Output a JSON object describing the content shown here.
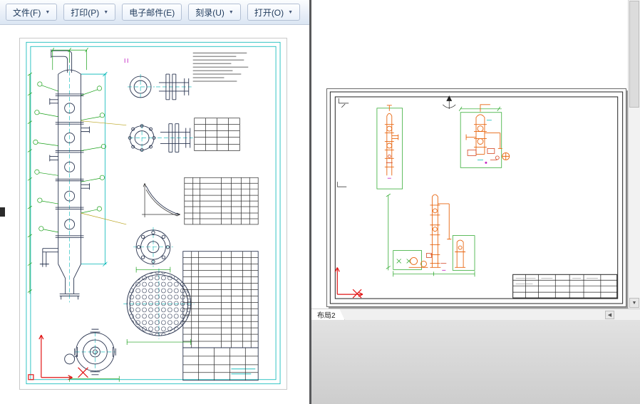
{
  "left_window": {
    "toolbar": {
      "buttons": [
        {
          "label": "文件(F)"
        },
        {
          "label": "打印(P)"
        },
        {
          "label": "电子邮件(E)"
        },
        {
          "label": "刻录(U)"
        },
        {
          "label": "打开(O)"
        }
      ]
    }
  },
  "right_window": {
    "layout_tab_label": "布局2"
  },
  "icons": {
    "dropdown": "▼",
    "scroll_left": "◀",
    "scroll_down": "▼"
  },
  "colors": {
    "toolbar_text": "#1e395b",
    "cad_cyan": "#00b6b6",
    "cad_green": "#18a018",
    "cad_orange": "#e8650f",
    "cad_red": "#e11414"
  }
}
